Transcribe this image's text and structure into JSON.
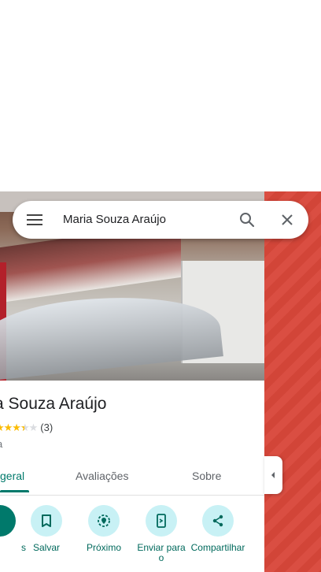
{
  "search": {
    "query": "Maria Souza Araújo"
  },
  "place": {
    "title": "a Souza Araújo",
    "rating_count": "(3)",
    "rating_value": 3.5,
    "category": "a"
  },
  "tabs": [
    {
      "label": "geral",
      "active": true
    },
    {
      "label": "Avaliações",
      "active": false
    },
    {
      "label": "Sobre",
      "active": false
    }
  ],
  "actions": [
    {
      "label": "s",
      "icon": "directions-icon"
    },
    {
      "label": "Salvar",
      "icon": "bookmark-icon"
    },
    {
      "label": "Próximo",
      "icon": "nearby-icon"
    },
    {
      "label": "Enviar para o",
      "icon": "send-to-phone-icon"
    },
    {
      "label": "Compartilhar",
      "icon": "share-icon"
    }
  ],
  "colors": {
    "accent": "#00796b",
    "chip": "#c8f1f5",
    "map": "#d9473a",
    "star": "#fbbc04"
  }
}
